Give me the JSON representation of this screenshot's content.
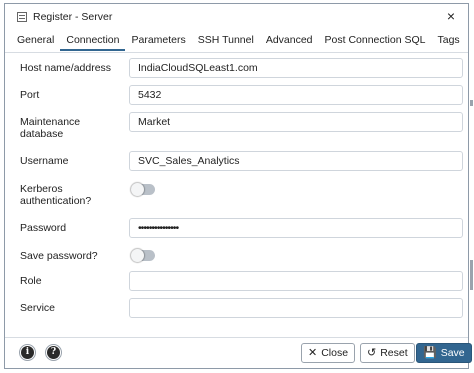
{
  "dialog": {
    "title": "Register - Server"
  },
  "tabs": [
    {
      "label": "General"
    },
    {
      "label": "Connection"
    },
    {
      "label": "Parameters"
    },
    {
      "label": "SSH Tunnel"
    },
    {
      "label": "Advanced"
    },
    {
      "label": "Post Connection SQL"
    },
    {
      "label": "Tags"
    }
  ],
  "active_tab": "Connection",
  "form": {
    "host": {
      "label": "Host name/address",
      "value": "IndiaCloudSQLeast1.com"
    },
    "port": {
      "label": "Port",
      "value": "5432"
    },
    "maintenance_db": {
      "label": "Maintenance database",
      "value": "Market"
    },
    "username": {
      "label": "Username",
      "value": "SVC_Sales_Analytics"
    },
    "kerberos": {
      "label": "Kerberos authentication?",
      "on": false
    },
    "password": {
      "label": "Password",
      "value": "•••••••••••••••"
    },
    "save_password": {
      "label": "Save password?",
      "on": false
    },
    "role": {
      "label": "Role",
      "value": ""
    },
    "service": {
      "label": "Service",
      "value": ""
    }
  },
  "footer": {
    "info_glyph": "i",
    "help_glyph": "?",
    "close_label": "Close",
    "reset_label": "Reset",
    "save_label": "Save"
  },
  "colors": {
    "accent": "#326690",
    "border": "#cfd5dc"
  }
}
